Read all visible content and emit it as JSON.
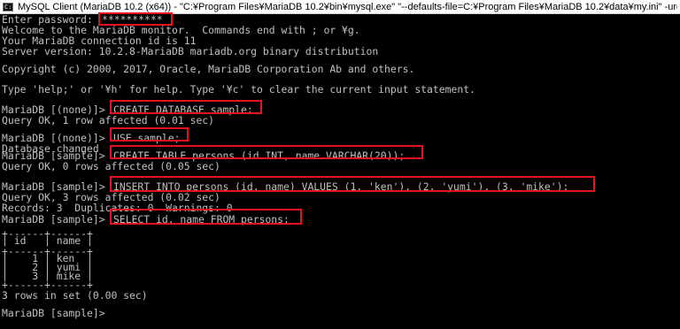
{
  "window": {
    "icon_text": "C:\\",
    "title": "MySQL Client (MariaDB 10.2 (x64)) - \"C:¥Program Files¥MariaDB 10.2¥bin¥mysql.exe\"  \"--defaults-file=C:¥Program Files¥MariaDB 10.2¥data¥my.ini\" -uroot -p"
  },
  "console": {
    "password_prompt": "Enter password: ",
    "password_value": "**********",
    "welcome": "Welcome to the MariaDB monitor.  Commands end with ; or ¥g.",
    "connection_id": "Your MariaDB connection id is 11",
    "server_version": "Server version: 10.2.8-MariaDB mariadb.org binary distribution",
    "copyright": "Copyright (c) 2000, 2017, Oracle, MariaDB Corporation Ab and others.",
    "help_text": "Type 'help;' or '¥h' for help. Type '¥c' to clear the current input statement.",
    "prompt_none": "MariaDB [(none)]> ",
    "prompt_sample": "MariaDB [sample]> ",
    "cmd_create_db": "CREATE DATABASE sample;",
    "res_create_db": "Query OK, 1 row affected (0.01 sec)",
    "cmd_use": "USE sample;",
    "res_use": "Database changed",
    "cmd_create_table": "CREATE TABLE persons (id INT, name VARCHAR(20));",
    "res_create_table": "Query OK, 0 rows affected (0.05 sec)",
    "cmd_insert": "INSERT INTO persons (id, name) VALUES (1, 'ken'), (2, 'yumi'), (3, 'mike');",
    "res_insert": "Query OK, 3 rows affected (0.02 sec)",
    "res_insert_records": "Records: 3  Duplicates: 0  Warnings: 0",
    "cmd_select": "SELECT id, name FROM persons;",
    "table": {
      "border": "+------+------+",
      "header": "| id   | name |",
      "rows": [
        "|    1 | ken  |",
        "|    2 | yumi |",
        "|    3 | mike |"
      ]
    },
    "rows_in_set": "3 rows in set (0.00 sec)",
    "final_prompt": "MariaDB [sample]> "
  },
  "colors": {
    "console_bg": "#000000",
    "console_text": "#c0c0c0",
    "highlight": "#e8111f"
  }
}
